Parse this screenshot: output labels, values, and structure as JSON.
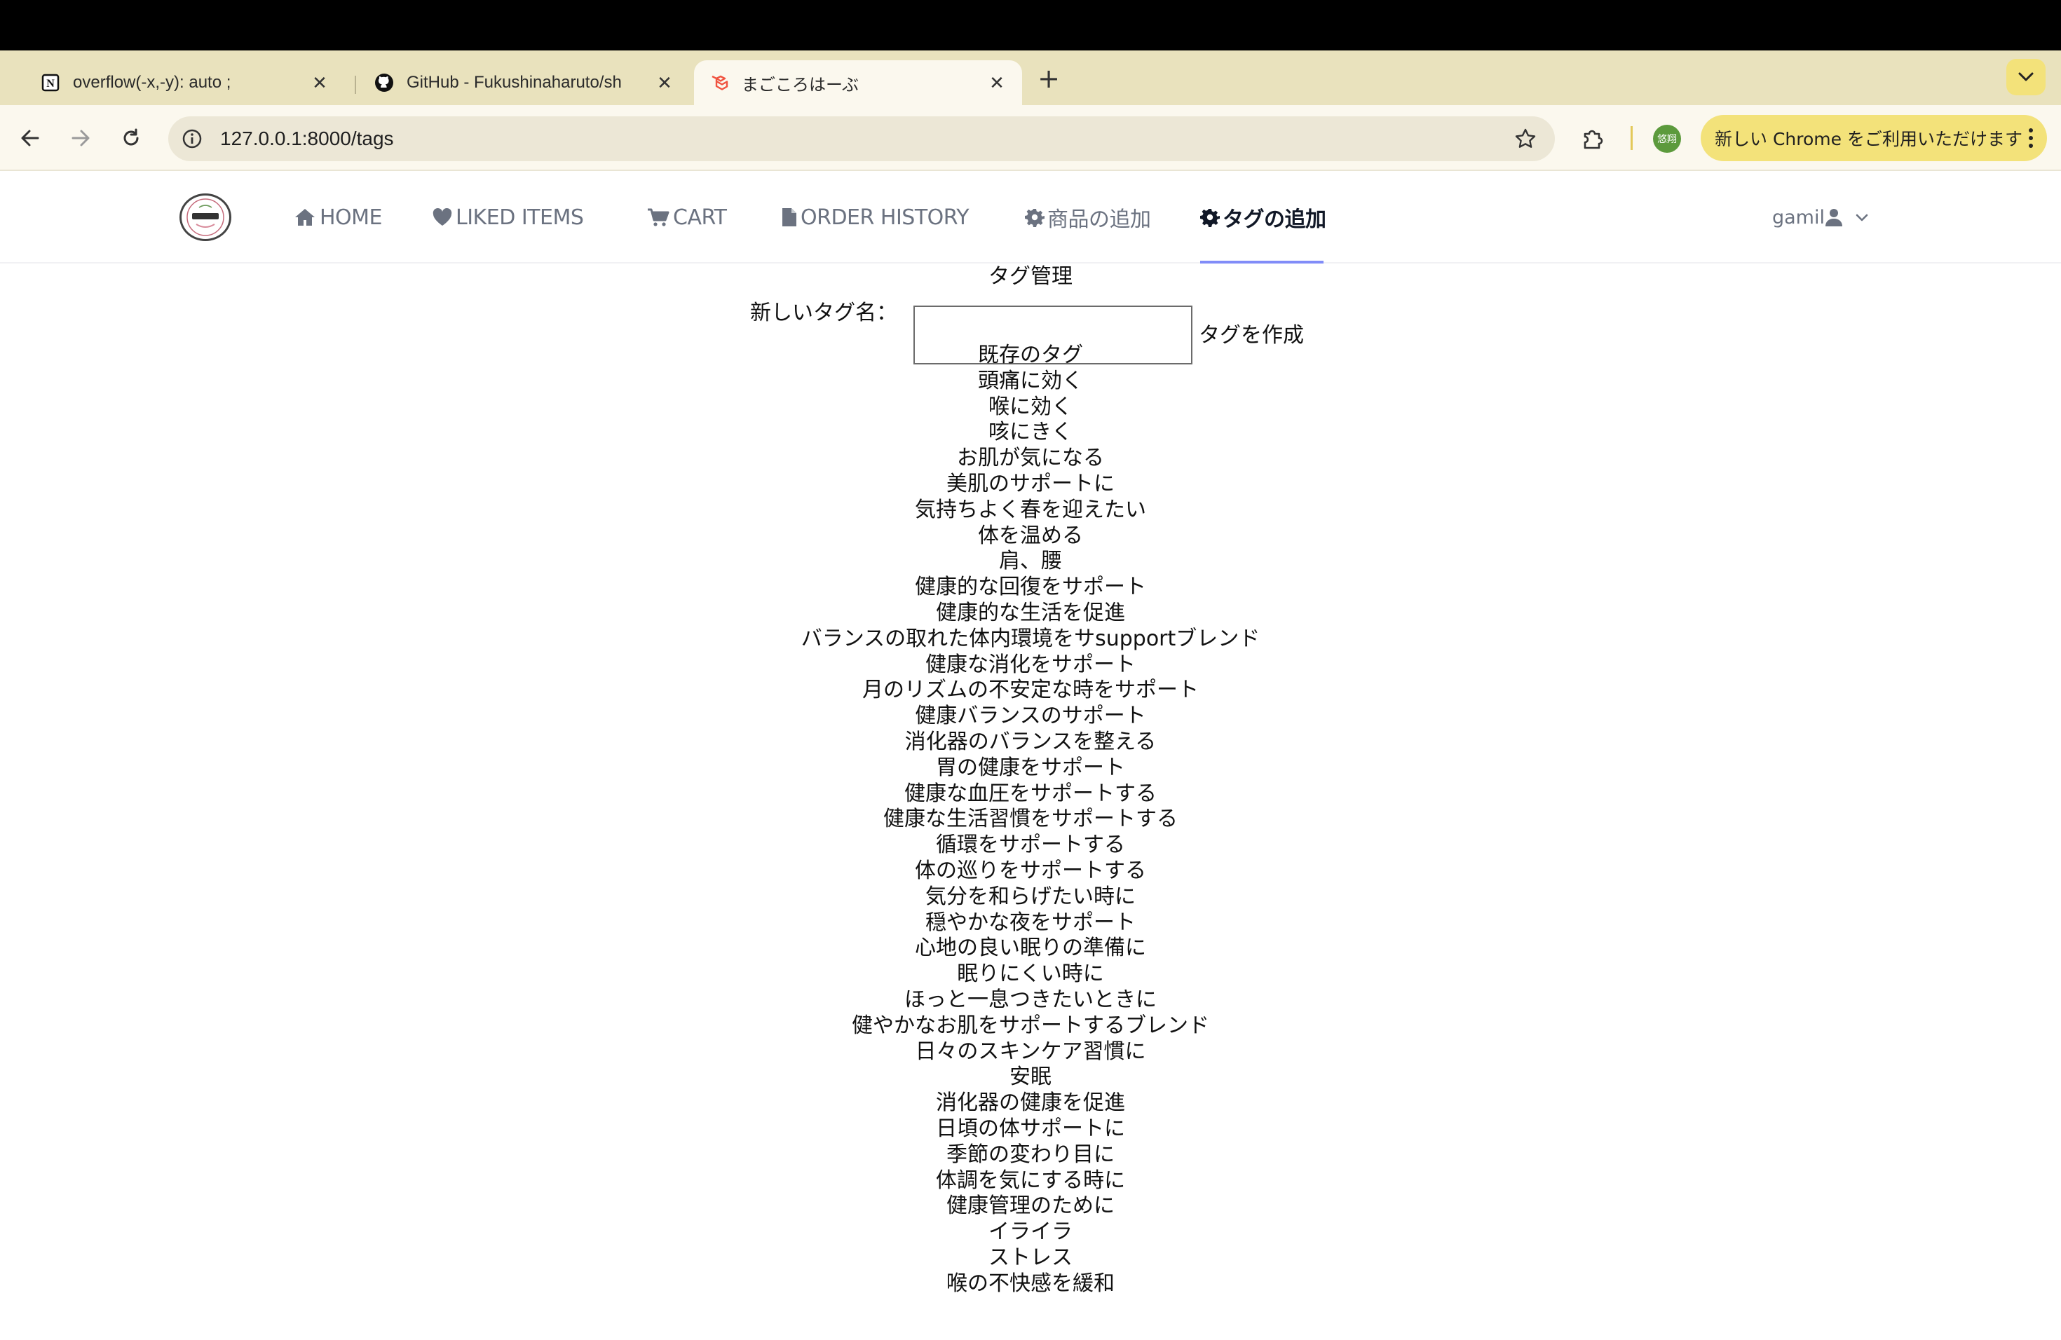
{
  "browser": {
    "tabs": [
      {
        "title": "overflow(-x,-y): auto ;",
        "icon": "notion-icon",
        "close": "✕"
      },
      {
        "title": "GitHub - Fukushinaharuto/sh",
        "icon": "github-icon",
        "close": "✕"
      },
      {
        "title": "まごころはーぶ",
        "icon": "laravel-icon",
        "close": "✕"
      }
    ],
    "new_tab": "+",
    "url": "127.0.0.1:8000/tags",
    "profile_initials": "悠翔",
    "update_message": "新しい Chrome をご利用いただけます"
  },
  "nav": {
    "logo_alt": "magokoro",
    "items": [
      {
        "label": "HOME",
        "icon": "home-icon"
      },
      {
        "label": "LIKED ITEMS",
        "icon": "heart-icon"
      },
      {
        "label": "CART",
        "icon": "cart-icon"
      },
      {
        "label": "ORDER HISTORY",
        "icon": "file-icon"
      },
      {
        "label": "商品の追加",
        "icon": "gear-icon"
      },
      {
        "label": "タグの追加",
        "icon": "gear-icon"
      }
    ],
    "user_name": "gamil"
  },
  "page": {
    "heading": "タグ管理",
    "new_tag_label": "新しいタグ名：",
    "new_tag_value": "",
    "create_button": "タグを作成",
    "existing_title": "既存のタグ",
    "tags": [
      "頭痛に効く",
      "喉に効く",
      "咳にきく",
      "お肌が気になる",
      "美肌のサポートに",
      "気持ちよく春を迎えたい",
      "体を温める",
      "肩、腰",
      "健康的な回復をサポート",
      "健康的な生活を促進",
      "バランスの取れた体内環境をサsupportブレンド",
      "健康な消化をサポート",
      "月のリズムの不安定な時をサポート",
      "健康バランスのサポート",
      "消化器のバランスを整える",
      "胃の健康をサポート",
      "健康な血圧をサポートする",
      "健康な生活習慣をサポートする",
      "循環をサポートする",
      "体の巡りをサポートする",
      "気分を和らげたい時に",
      "穏やかな夜をサポート",
      "心地の良い眠りの準備に",
      "眠りにくい時に",
      "ほっと一息つきたいときに",
      "健やかなお肌をサポートするブレンド",
      "日々のスキンケア習慣に",
      "安眠",
      "消化器の健康を促進",
      "日頃の体サポートに",
      "季節の変わり目に",
      "体調を気にする時に",
      "健康管理のために",
      "イライラ",
      "ストレス",
      "喉の不快感を緩和"
    ]
  }
}
